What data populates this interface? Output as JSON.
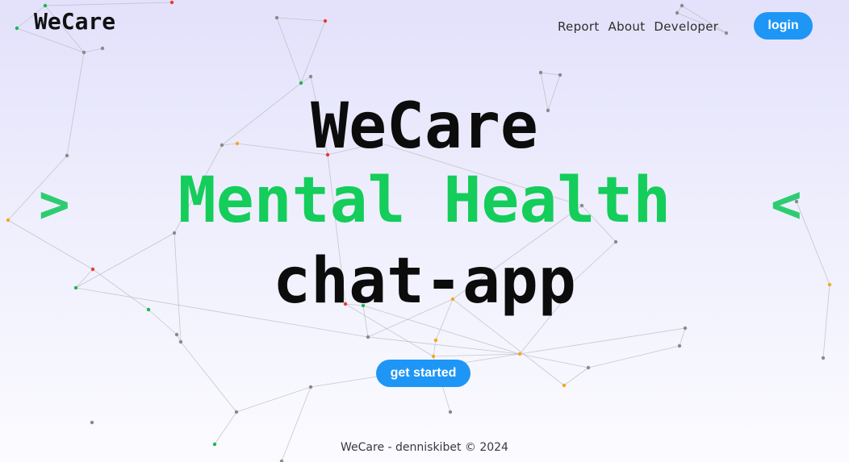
{
  "brand": {
    "logo_text": "WeCare"
  },
  "nav": {
    "items": [
      {
        "label": "Report"
      },
      {
        "label": "About"
      },
      {
        "label": "Developer"
      }
    ],
    "login_label": "login"
  },
  "hero": {
    "line1": "WeCare",
    "line2": "Mental Health",
    "line3": "chat-app",
    "chevron_left_glyph": ">",
    "chevron_right_glyph": "<",
    "cta_label": "get started"
  },
  "footer": {
    "text": "WeCare - denniskibet © 2024"
  },
  "colors": {
    "accent_green": "#14cd5a",
    "button_blue": "#1e96f5",
    "background_top": "#e3e1fb",
    "background_bottom": "#fbfbff"
  }
}
